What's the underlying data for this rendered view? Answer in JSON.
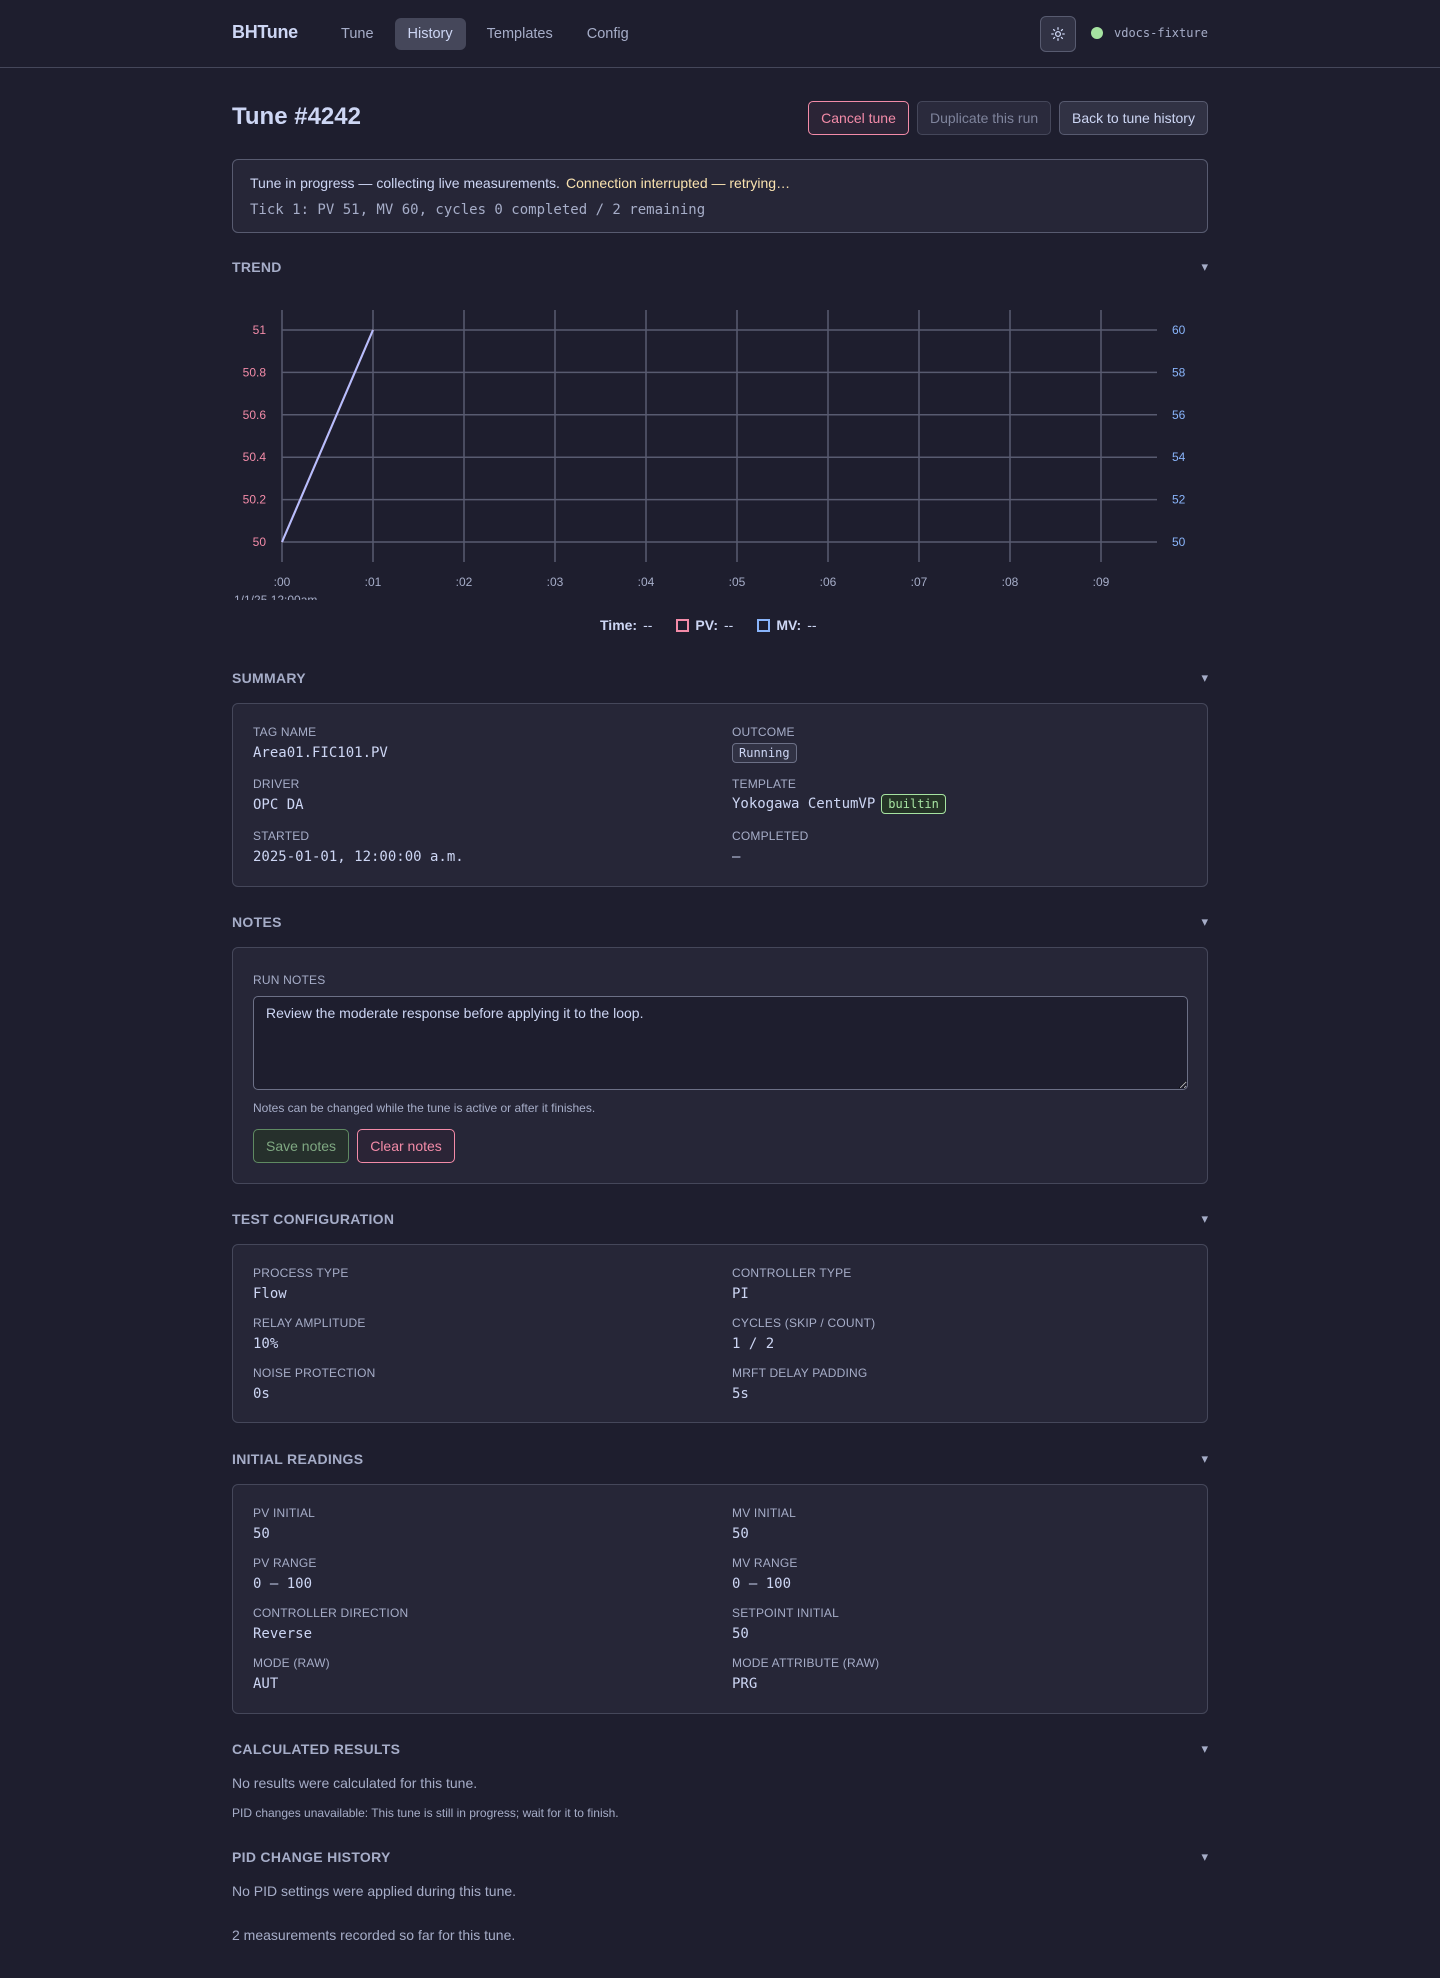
{
  "header": {
    "brand": "BHTune",
    "nav": [
      "Tune",
      "History",
      "Templates",
      "Config"
    ],
    "active_nav": "History",
    "connection_name": "vdocs-fixture",
    "theme_icon": "sun-icon"
  },
  "page": {
    "title": "Tune #4242",
    "cancel_label": "Cancel tune",
    "duplicate_label": "Duplicate this run",
    "back_label": "Back to tune history"
  },
  "banner": {
    "status": "Tune in progress — collecting live measurements.",
    "warning": "Connection interrupted — retrying…",
    "tick": "Tick 1: PV 51, MV 60, cycles 0 completed / 2 remaining"
  },
  "trend": {
    "section_title": "TREND",
    "toggle": "▾",
    "time_origin_label": "1/1/25 12:00am",
    "legend": {
      "time_label": "Time:",
      "time_value": "--",
      "pv_label": "PV:",
      "pv_value": "--",
      "mv_label": "MV:",
      "mv_value": "--"
    }
  },
  "chart_data": {
    "type": "line",
    "x_ticks": [
      ":00",
      ":01",
      ":02",
      ":03",
      ":04",
      ":05",
      ":06",
      ":07",
      ":08",
      ":09"
    ],
    "x": [
      0,
      1
    ],
    "series": [
      {
        "name": "PV",
        "axis": "left",
        "values": [
          50,
          51
        ],
        "color": "#f38ba8"
      },
      {
        "name": "MV",
        "axis": "right",
        "values": [
          50,
          60
        ],
        "color": "#b4befe"
      }
    ],
    "left_axis": {
      "ticks": [
        "50",
        "50.2",
        "50.4",
        "50.6",
        "50.8",
        "51"
      ],
      "ylim": [
        50,
        51
      ],
      "color": "#f38ba8"
    },
    "right_axis": {
      "ticks": [
        "50",
        "52",
        "54",
        "56",
        "58",
        "60"
      ],
      "ylim": [
        50,
        60
      ],
      "color": "#89b4fa"
    },
    "xlim": [
      0,
      9.6
    ],
    "grid": true
  },
  "summary": {
    "section_title": "SUMMARY",
    "toggle": "▾",
    "tag_name_label": "TAG NAME",
    "tag_name": "Area01.FIC101.PV",
    "outcome_label": "OUTCOME",
    "outcome": "Running",
    "driver_label": "DRIVER",
    "driver": "OPC DA",
    "template_label": "TEMPLATE",
    "template": "Yokogawa CentumVP",
    "template_badge": "builtin",
    "started_label": "STARTED",
    "started": "2025-01-01, 12:00:00 a.m.",
    "completed_label": "COMPLETED",
    "completed": "—"
  },
  "notes": {
    "section_title": "NOTES",
    "toggle": "▾",
    "run_notes_label": "RUN NOTES",
    "run_notes_value": "Review the moderate response before applying it to the loop.",
    "help": "Notes can be changed while the tune is active or after it finishes.",
    "save_label": "Save notes",
    "clear_label": "Clear notes"
  },
  "test_config": {
    "section_title": "TEST CONFIGURATION",
    "toggle": "▾",
    "fields": [
      {
        "label": "PROCESS TYPE",
        "value": "Flow"
      },
      {
        "label": "CONTROLLER TYPE",
        "value": "PI"
      },
      {
        "label": "RELAY AMPLITUDE",
        "value": "10%"
      },
      {
        "label": "CYCLES (SKIP / COUNT)",
        "value": "1 / 2"
      },
      {
        "label": "NOISE PROTECTION",
        "value": "0s"
      },
      {
        "label": "MRFT DELAY PADDING",
        "value": "5s"
      }
    ]
  },
  "initial_readings": {
    "section_title": "INITIAL READINGS",
    "toggle": "▾",
    "fields": [
      {
        "label": "PV INITIAL",
        "value": "50"
      },
      {
        "label": "MV INITIAL",
        "value": "50"
      },
      {
        "label": "PV RANGE",
        "value": "0 – 100"
      },
      {
        "label": "MV RANGE",
        "value": "0 – 100"
      },
      {
        "label": "CONTROLLER DIRECTION",
        "value": "Reverse"
      },
      {
        "label": "SETPOINT INITIAL",
        "value": "50"
      },
      {
        "label": "MODE (RAW)",
        "value": "AUT"
      },
      {
        "label": "MODE ATTRIBUTE (RAW)",
        "value": "PRG"
      }
    ]
  },
  "calculated_results": {
    "section_title": "CALCULATED RESULTS",
    "toggle": "▾",
    "message": "No results were calculated for this tune.",
    "note": "PID changes unavailable: This tune is still in progress; wait for it to finish."
  },
  "pid_history": {
    "section_title": "PID CHANGE HISTORY",
    "toggle": "▾",
    "message": "No PID settings were applied during this tune.",
    "measurements": "2 measurements recorded so far for this tune."
  }
}
